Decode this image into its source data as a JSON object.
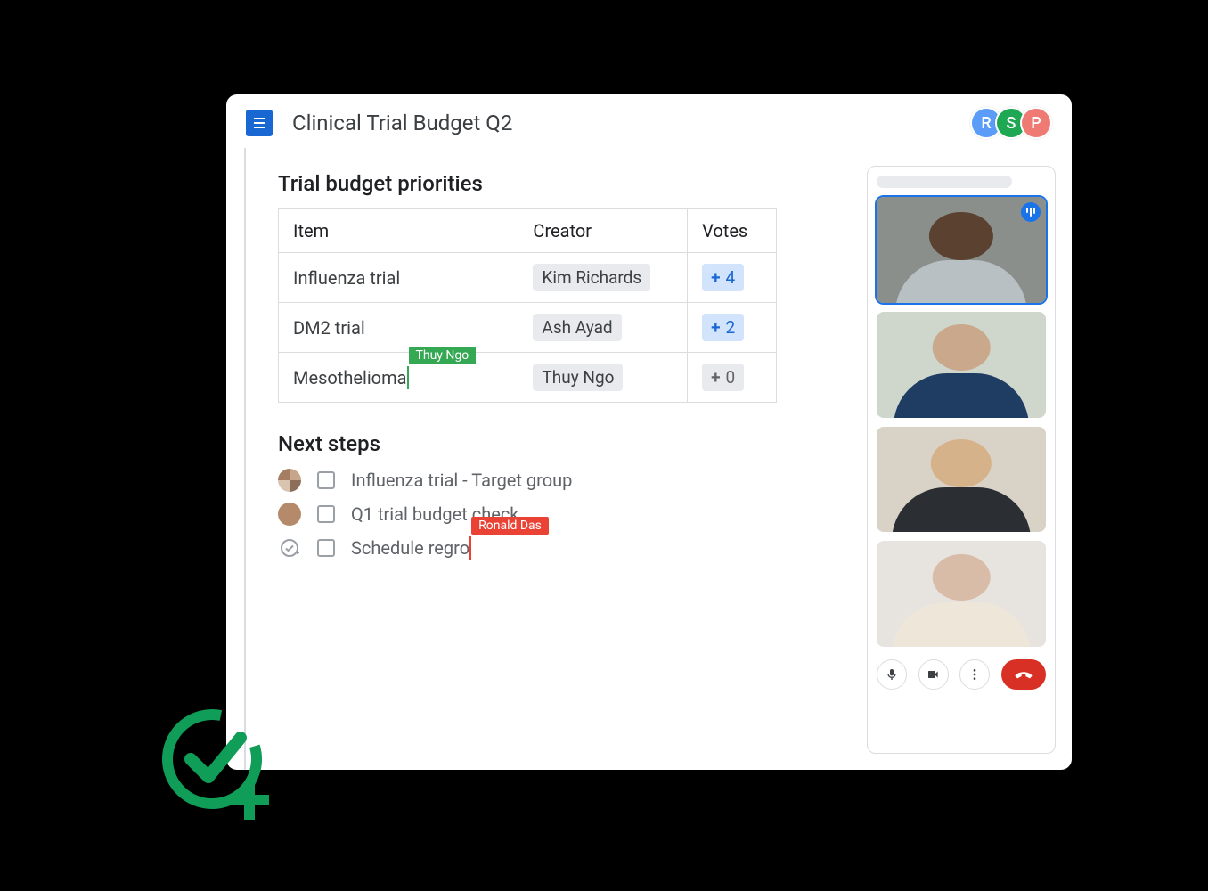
{
  "header": {
    "title": "Clinical Trial Budget Q2",
    "collaborators": [
      {
        "initial": "R",
        "color": "#5a9cf7"
      },
      {
        "initial": "S",
        "color": "#1fa853"
      },
      {
        "initial": "P",
        "color": "#ef7a74"
      }
    ]
  },
  "doc": {
    "section1_title": "Trial budget priorities",
    "table": {
      "headers": {
        "item": "Item",
        "creator": "Creator",
        "votes": "Votes"
      },
      "rows": [
        {
          "item": "Influenza trial",
          "creator": "Kim Richards",
          "votes": 4,
          "votes_display": "4",
          "positive": true
        },
        {
          "item": "DM2 trial",
          "creator": "Ash Ayad",
          "votes": 2,
          "votes_display": "2",
          "positive": true
        },
        {
          "item": "Mesothelioma",
          "creator": "Thuy Ngo",
          "votes": 0,
          "votes_display": "0",
          "positive": false,
          "cursor": {
            "user": "Thuy Ngo",
            "color": "#34a853"
          }
        }
      ]
    },
    "section2_title": "Next steps",
    "steps": [
      {
        "label": "Influenza trial - Target group",
        "assignee_type": "multi"
      },
      {
        "label": "Q1 trial budget check",
        "assignee_type": "single"
      },
      {
        "label": "Schedule regro",
        "assignee_type": "addtask",
        "cursor": {
          "user": "Ronald Das",
          "color": "#ea4335"
        }
      }
    ]
  },
  "video": {
    "participants_count": 4,
    "active_speaker_index": 0
  }
}
